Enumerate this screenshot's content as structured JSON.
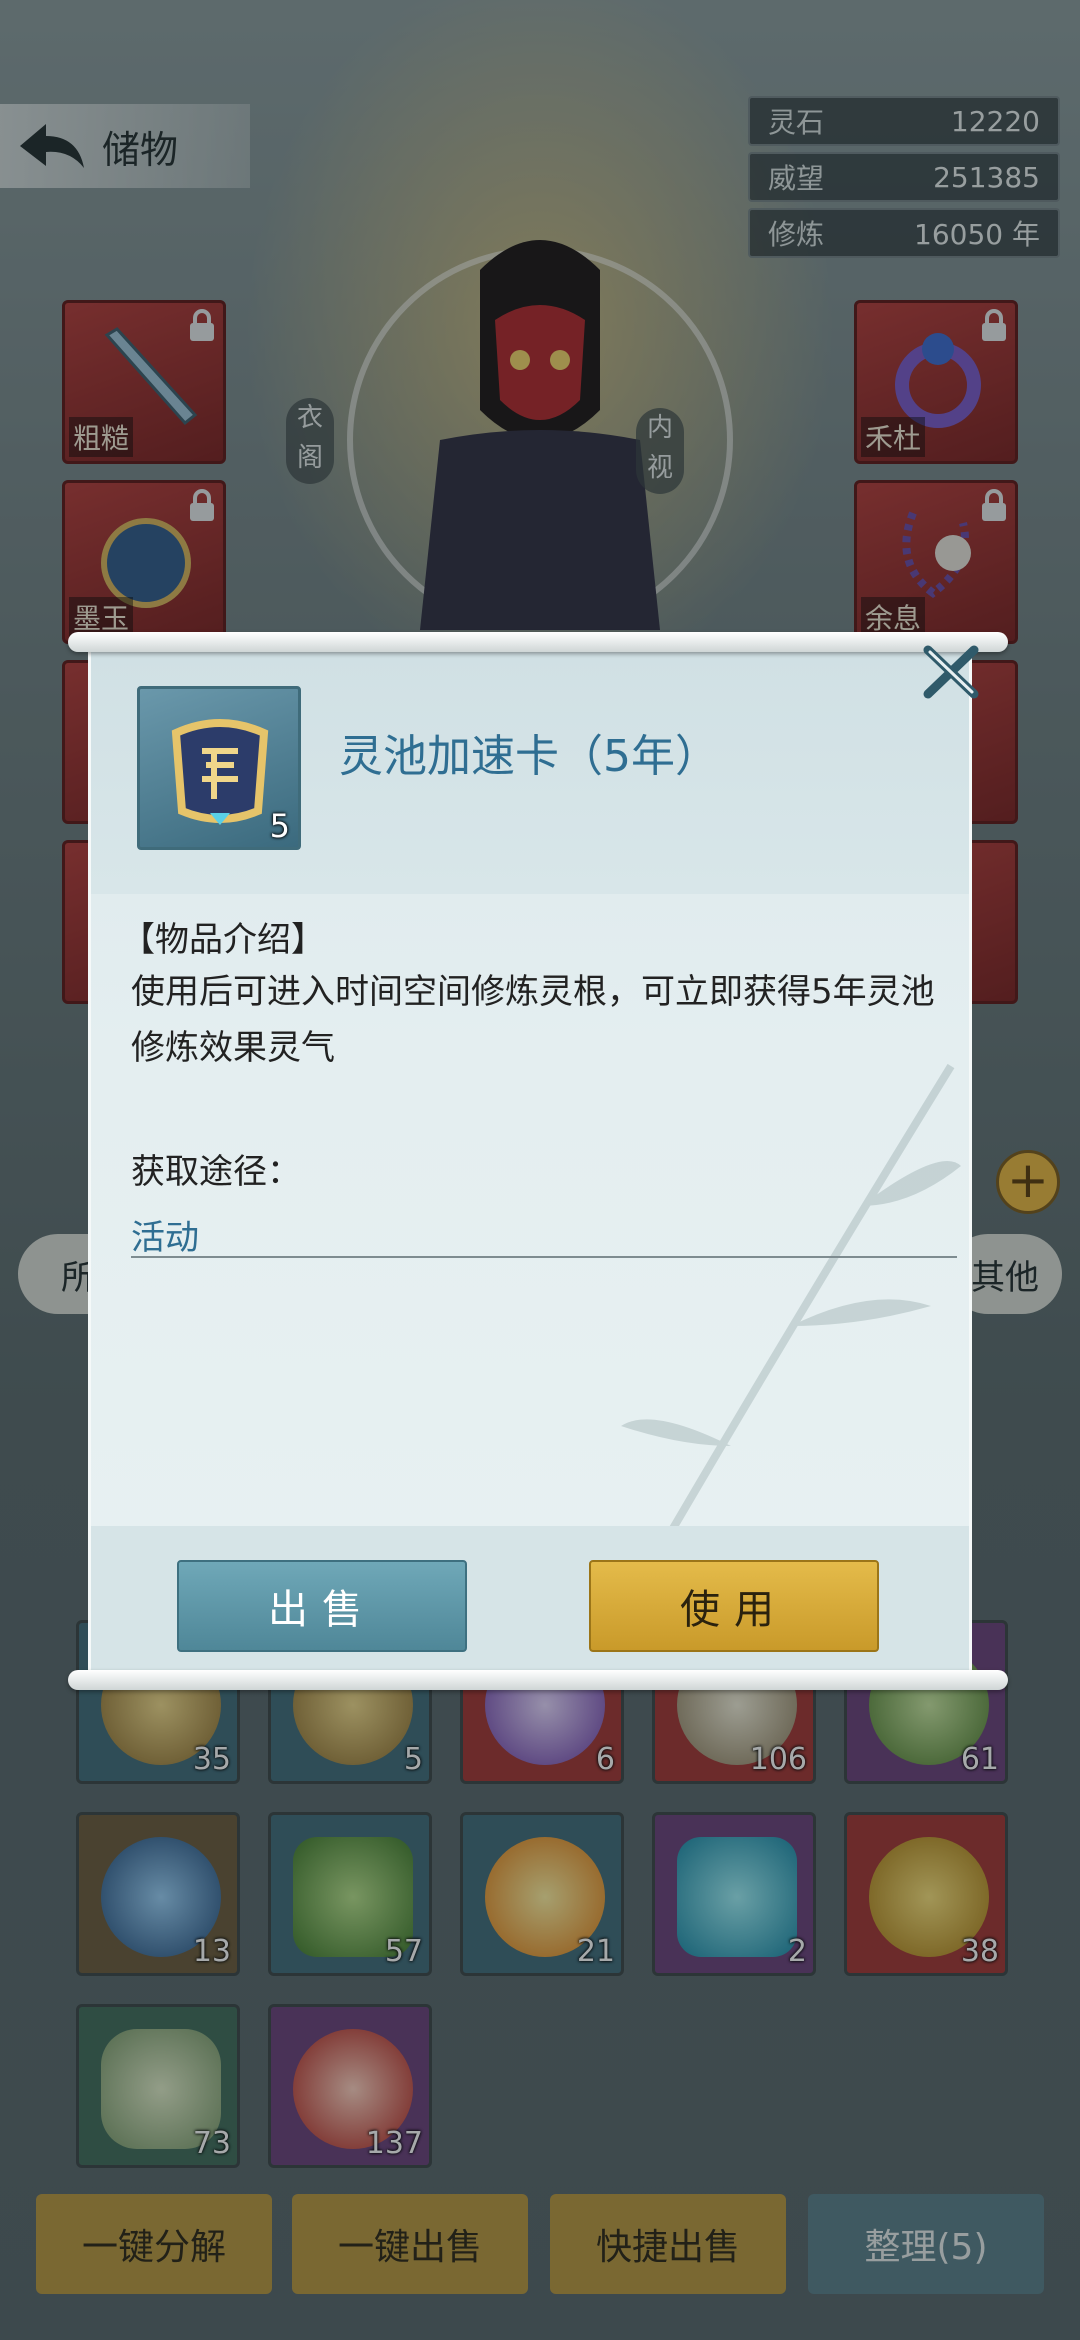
{
  "header": {
    "back_label": "储物",
    "resources": [
      {
        "label": "灵石",
        "value": "12220"
      },
      {
        "label": "威望",
        "value": "251385"
      },
      {
        "label": "修炼",
        "value": "16050 年"
      }
    ]
  },
  "character": {
    "left_emblem": "衣阁",
    "right_emblem": "内视"
  },
  "equipment_slots": {
    "left": [
      {
        "tag": "粗糙",
        "icon": "sword-icon"
      },
      {
        "tag": "墨玉",
        "icon": "helmet-icon"
      }
    ],
    "right": [
      {
        "tag": "禾杜",
        "icon": "ring-icon"
      },
      {
        "tag": "余息",
        "icon": "beads-icon"
      }
    ]
  },
  "category_tabs": {
    "first": "所",
    "last": "其他"
  },
  "inventory": {
    "row1": [
      {
        "count": "35",
        "color": "#3f6b7a"
      },
      {
        "count": "5",
        "color": "#3f6b7a"
      },
      {
        "count": "6",
        "color": "#a23432"
      },
      {
        "count": "106",
        "color": "#a23432"
      },
      {
        "count": "61",
        "color": "#6a3f7a"
      }
    ],
    "row2": [
      {
        "count": "13",
        "color": "#6b5a3a"
      },
      {
        "count": "57",
        "color": "#3f6b7a"
      },
      {
        "count": "21",
        "color": "#3f6b7a"
      },
      {
        "count": "2",
        "color": "#6a3f7a"
      },
      {
        "count": "38",
        "color": "#a23432"
      }
    ],
    "row3": [
      {
        "count": "73",
        "color": "#3f6b5a"
      },
      {
        "count": "137",
        "color": "#6a3f7a"
      }
    ]
  },
  "bottom_actions": {
    "decompose": "一键分解",
    "sell_all": "一键出售",
    "quick_sell": "快捷出售",
    "sort": "整理(5)"
  },
  "modal": {
    "item_name": "灵池加速卡（5年）",
    "item_qty": "5",
    "desc_heading": "【物品介绍】",
    "desc_text": "使用后可进入时间空间修炼灵根，可立即获得5年灵池修炼效果灵气",
    "source_heading": "获取途径：",
    "source_value": "活动",
    "sell_label": "出售",
    "use_label": "使用"
  },
  "colors": {
    "accent_blue": "#2f6e92",
    "use_gold": "#d6a93a",
    "sell_teal": "#5f97a8"
  }
}
